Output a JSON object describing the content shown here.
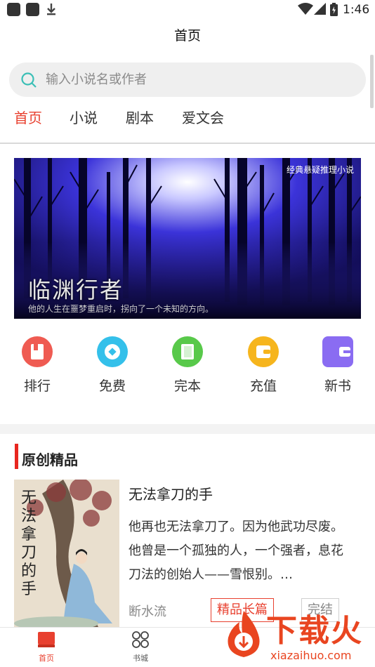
{
  "status_bar": {
    "time": "1:46"
  },
  "header": {
    "title": "首页"
  },
  "search": {
    "placeholder": "输入小说名或作者"
  },
  "tabs": [
    {
      "label": "首页",
      "active": true
    },
    {
      "label": "小说",
      "active": false
    },
    {
      "label": "剧本",
      "active": false
    },
    {
      "label": "爱文会",
      "active": false
    }
  ],
  "banner": {
    "tag": "经典悬疑推理小说",
    "title": "临渊行者",
    "subtitle": "他的人生在噩梦重启时，拐向了一个未知的方向。"
  },
  "quick_links": [
    {
      "label": "排行",
      "icon": "ranking-icon",
      "color": "#ef5b52"
    },
    {
      "label": "免费",
      "icon": "free-icon",
      "color": "#34c0ea"
    },
    {
      "label": "完本",
      "icon": "complete-book-icon",
      "color": "#58c94a"
    },
    {
      "label": "充值",
      "icon": "wallet-icon",
      "color": "#f6b51d"
    },
    {
      "label": "新书",
      "icon": "new-book-icon",
      "color": "#8a6cf2"
    }
  ],
  "section": {
    "title": "原创精品"
  },
  "book": {
    "cover_title": "无法拿刀的手",
    "title": "无法拿刀的手",
    "description": "他再也无法拿刀了。因为他武功尽废。他曾是一个孤独的人，一个强者，息花刀法的创始人——雪恨别。…",
    "author": "断水流",
    "tag_primary": "精品长篇",
    "tag_status": "完结"
  },
  "bottom_nav": [
    {
      "label": "首页",
      "icon": "home-book-icon",
      "active": true
    },
    {
      "label": "书城",
      "icon": "bookstore-grid-icon",
      "active": false
    }
  ],
  "watermark": {
    "text": "下载火",
    "url": "xiazaihuo.com"
  },
  "colors": {
    "accent": "#e8402f",
    "section_bar": "#e8261f"
  }
}
